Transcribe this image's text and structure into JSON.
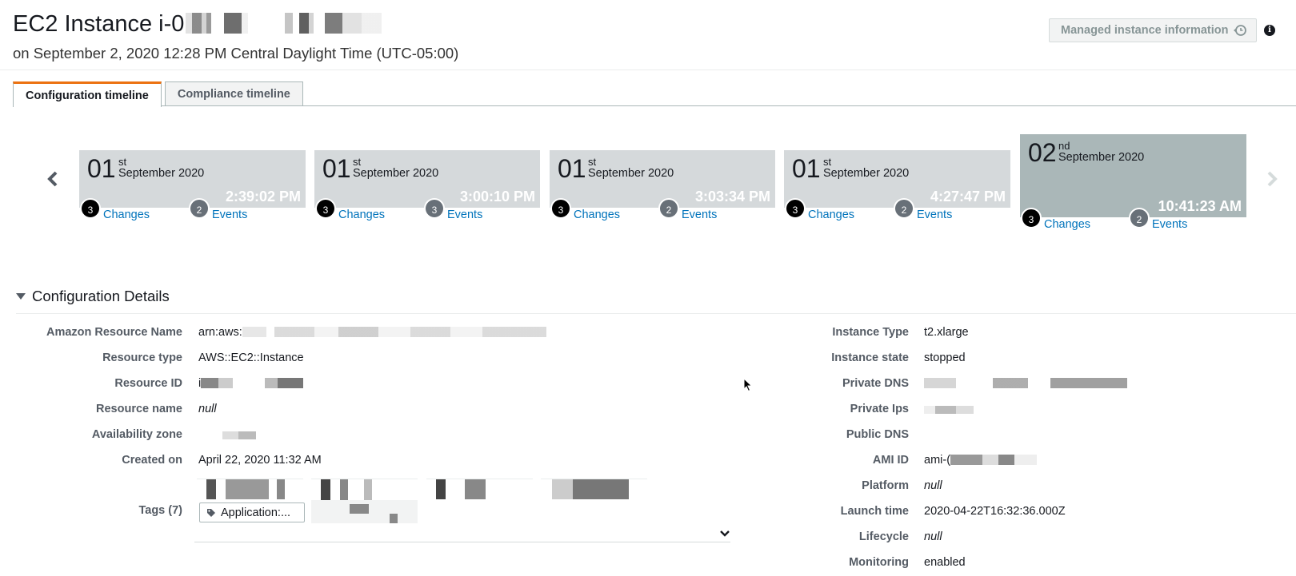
{
  "header": {
    "title": "EC2 Instance i-0",
    "subtitle": "on September 2, 2020 12:28 PM Central Daylight Time (UTC-05:00)",
    "managed_button": "Managed instance information",
    "info_glyph": "i"
  },
  "tabs": [
    {
      "label": "Configuration timeline",
      "active": true
    },
    {
      "label": "Compliance timeline",
      "active": false
    }
  ],
  "timeline": [
    {
      "day": "01",
      "suffix": "st",
      "month": "September 2020",
      "time": "2:39:02 PM",
      "changes": "3",
      "events": "2",
      "changes_label": "Changes",
      "events_label": "Events",
      "selected": false
    },
    {
      "day": "01",
      "suffix": "st",
      "month": "September 2020",
      "time": "3:00:10 PM",
      "changes": "3",
      "events": "3",
      "changes_label": "Changes",
      "events_label": "Events",
      "selected": false
    },
    {
      "day": "01",
      "suffix": "st",
      "month": "September 2020",
      "time": "3:03:34 PM",
      "changes": "3",
      "events": "2",
      "changes_label": "Changes",
      "events_label": "Events",
      "selected": false
    },
    {
      "day": "01",
      "suffix": "st",
      "month": "September 2020",
      "time": "4:27:47 PM",
      "changes": "3",
      "events": "2",
      "changes_label": "Changes",
      "events_label": "Events",
      "selected": false
    },
    {
      "day": "02",
      "suffix": "nd",
      "month": "September 2020",
      "time": "10:41:23 AM",
      "changes": "3",
      "events": "2",
      "changes_label": "Changes",
      "events_label": "Events",
      "selected": true
    }
  ],
  "details": {
    "section_title": "Configuration Details",
    "left": [
      {
        "label": "Amazon Resource Name",
        "value": "arn:aws:"
      },
      {
        "label": "Resource type",
        "value": "AWS::EC2::Instance"
      },
      {
        "label": "Resource ID",
        "value": "i"
      },
      {
        "label": "Resource name",
        "value": "null"
      },
      {
        "label": "Availability zone",
        "value": ""
      },
      {
        "label": "Created on",
        "value": "April 22, 2020 11:32 AM"
      }
    ],
    "tags_label": "Tags (7)",
    "tag_pill": "Application:...",
    "right": [
      {
        "label": "Instance Type",
        "value": "t2.xlarge"
      },
      {
        "label": "Instance state",
        "value": "stopped"
      },
      {
        "label": "Private DNS",
        "value": ""
      },
      {
        "label": "Private Ips",
        "value": ""
      },
      {
        "label": "Public DNS",
        "value": ""
      },
      {
        "label": "AMI ID",
        "value": "ami-("
      },
      {
        "label": "Platform",
        "value": "null"
      },
      {
        "label": "Launch time",
        "value": "2020-04-22T16:32:36.000Z"
      },
      {
        "label": "Lifecycle",
        "value": "null"
      },
      {
        "label": "Monitoring",
        "value": "enabled"
      }
    ]
  },
  "colors": {
    "accent_tab": "#ec7211",
    "link": "#0073bb",
    "card": "#d5d9db",
    "card_selected": "#aab7b8"
  },
  "icons": [
    "chevron-left-icon",
    "chevron-right-icon",
    "clock-icon",
    "info-icon",
    "caret-down-icon",
    "tag-icon",
    "chevron-down-icon",
    "mouse-cursor-icon"
  ]
}
